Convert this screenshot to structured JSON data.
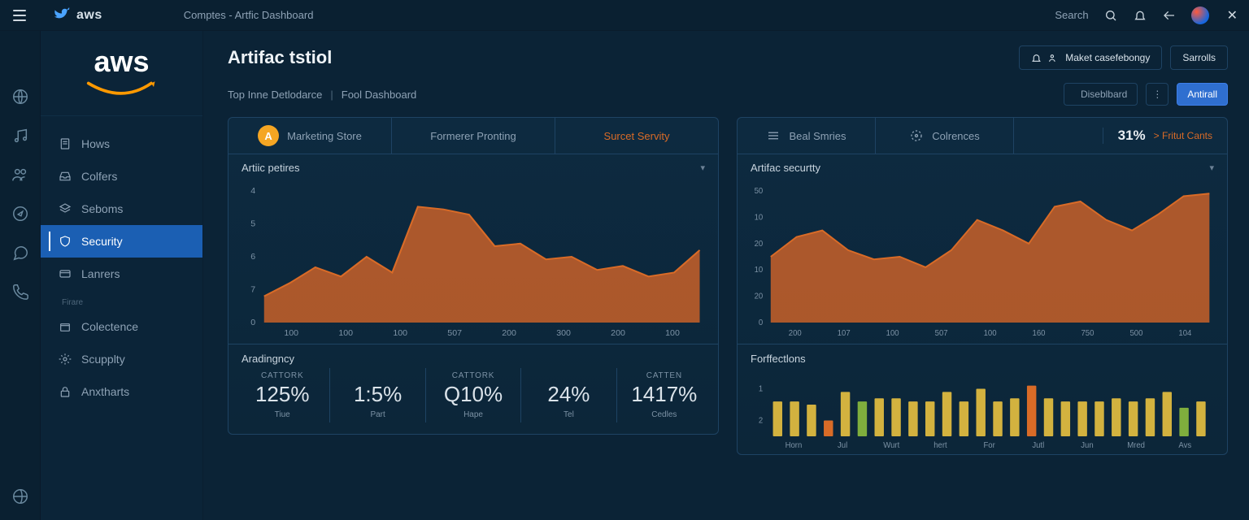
{
  "titlebar": {
    "brand": "aws",
    "tab": "Comptes - Artfic Dashboard",
    "search_label": "Search"
  },
  "sidebar": {
    "logo": "aws",
    "items": [
      {
        "label": "Hows"
      },
      {
        "label": "Colfers"
      },
      {
        "label": "Seboms"
      },
      {
        "label": "Security"
      },
      {
        "label": "Lanrers"
      }
    ],
    "section_label": "Firare",
    "items2": [
      {
        "label": "Colectence"
      },
      {
        "label": "Scupplty"
      },
      {
        "label": "Anxtharts"
      }
    ]
  },
  "page": {
    "title": "Artifac tstiol",
    "action_primary": "Maket casefebongy",
    "action_secondary": "Sarrolls",
    "crumbs": [
      "Top Inne Detlodarce",
      "Fool Dashboard"
    ],
    "chip_dashboard": "Diseblbard",
    "chip_primary": "Antirall"
  },
  "left_panel": {
    "tabs": [
      {
        "avatar": "A",
        "label": "Marketing Store"
      },
      {
        "label": "Formerer Pronting"
      },
      {
        "label": "Surcet Servity"
      }
    ],
    "sub_title": "Artiic petires",
    "metrics_title": "Aradingncy",
    "metrics": [
      {
        "cap": "CATTORK",
        "val": "125%",
        "sub": "Tiue"
      },
      {
        "cap": "",
        "val": "1:5%",
        "sub": "Part"
      },
      {
        "cap": "CATTORK",
        "val": "Q10%",
        "sub": "Hape"
      },
      {
        "cap": "",
        "val": "24%",
        "sub": "Tel"
      },
      {
        "cap": "CATTEN",
        "val": "1417%",
        "sub": "Cedles"
      }
    ]
  },
  "right_panel": {
    "tabs": [
      {
        "icon": "menu",
        "label": "Beal Smries"
      },
      {
        "icon": "gear",
        "label": "Colrences"
      }
    ],
    "stat": "31%",
    "stat_link": "> Fritut Cants",
    "sub_title": "Artifac securtty",
    "bars_title": "Forffectlons"
  },
  "chart_data": [
    {
      "type": "area",
      "title": "Artiic petires",
      "y_ticks": [
        4,
        5,
        6,
        7,
        0
      ],
      "x_ticks": [
        100,
        100,
        100,
        507,
        200,
        300,
        200,
        100
      ],
      "values": [
        0.2,
        0.3,
        0.42,
        0.35,
        0.5,
        0.38,
        0.88,
        0.86,
        0.82,
        0.58,
        0.6,
        0.48,
        0.5,
        0.4,
        0.43,
        0.35,
        0.38,
        0.55
      ]
    },
    {
      "type": "area",
      "title": "Artifac securtty",
      "y_ticks": [
        50,
        10,
        20,
        10,
        20,
        0
      ],
      "x_ticks": [
        200,
        107,
        100,
        507,
        100,
        160,
        750,
        500,
        104
      ],
      "values": [
        0.5,
        0.65,
        0.7,
        0.55,
        0.48,
        0.5,
        0.42,
        0.55,
        0.78,
        0.7,
        0.6,
        0.88,
        0.92,
        0.78,
        0.7,
        0.82,
        0.96,
        0.98
      ]
    },
    {
      "type": "bar",
      "title": "Forffectlons",
      "y_ticks": [
        1,
        2
      ],
      "categories": [
        "Horn",
        "Jul",
        "Wurt",
        "hert",
        "For",
        "Jutl",
        "Jun",
        "Mred",
        "Avs"
      ],
      "series": [
        {
          "color": "y",
          "values": [
            0.55,
            0.55,
            0.5,
            0.25,
            0.7,
            0.55,
            0.6,
            0.6,
            0.55,
            0.55,
            0.7,
            0.55,
            0.75,
            0.55,
            0.6,
            0.8,
            0.6,
            0.55,
            0.55,
            0.55,
            0.6,
            0.55,
            0.6,
            0.7,
            0.45,
            0.55
          ]
        },
        {
          "color": "o",
          "indices": [
            3,
            15
          ]
        },
        {
          "color": "g",
          "indices": [
            5,
            24
          ]
        }
      ]
    }
  ]
}
